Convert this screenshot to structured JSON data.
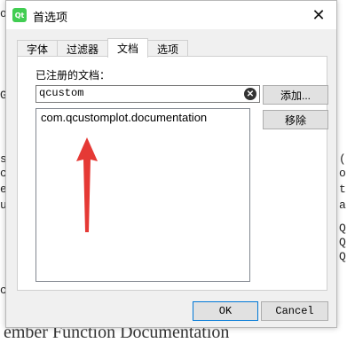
{
  "background": {
    "fragments": [
      "o",
      "G",
      "s",
      "c",
      "e",
      "u",
      "c",
      "(",
      "o",
      "t",
      "a",
      "Q",
      "Q",
      "Q"
    ],
    "heading": "ember Function Documentation"
  },
  "dialog": {
    "icon_text": "Qt",
    "title": "首选项",
    "tabs": [
      {
        "label": "字体"
      },
      {
        "label": "过滤器"
      },
      {
        "label": "文档"
      },
      {
        "label": "选项"
      }
    ],
    "registered_label": "已注册的文档：",
    "search_value": "qcustom",
    "documents": [
      "com.qcustomplot.documentation"
    ],
    "add_button": "添加...",
    "remove_button": "移除",
    "ok_button": "OK",
    "cancel_button": "Cancel",
    "annotation_color": "#e53935"
  }
}
